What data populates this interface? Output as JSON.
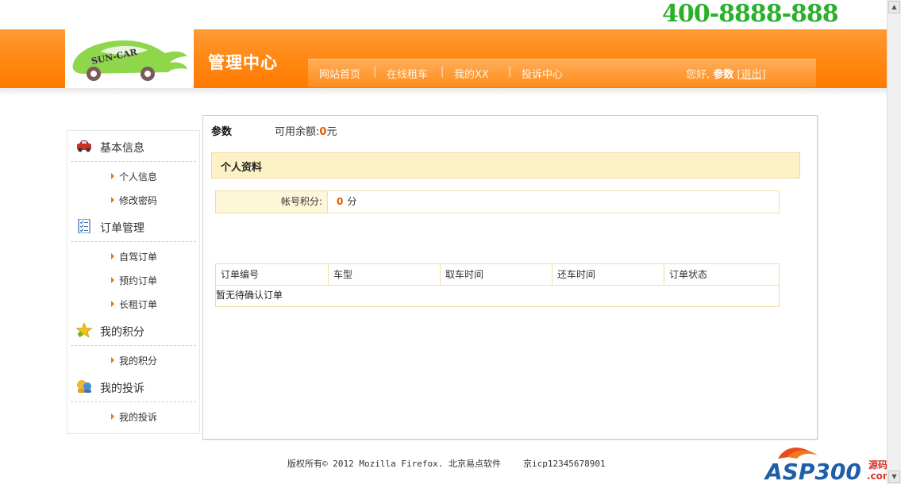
{
  "header": {
    "phone": "400-8888-888",
    "logo_text": "SUN-CAR",
    "title": "管理中心",
    "nav": [
      "网站首页",
      "在线租车",
      "我的XX",
      "投诉中心"
    ],
    "greeting_prefix": "您好,",
    "username": "参数",
    "logout_open": "[",
    "logout_label": "退出",
    "logout_close": "]"
  },
  "sidebar": {
    "sections": [
      {
        "title": "基本信息",
        "icon": "car-icon",
        "items": [
          "个人信息",
          "修改密码"
        ]
      },
      {
        "title": "订单管理",
        "icon": "checklist-icon",
        "items": [
          "自驾订单",
          "预约订单",
          "长租订单"
        ]
      },
      {
        "title": "我的积分",
        "icon": "star-icon",
        "items": [
          "我的积分"
        ]
      },
      {
        "title": "我的投诉",
        "icon": "people-icon",
        "items": [
          "我的投诉"
        ]
      }
    ]
  },
  "main": {
    "username": "参数",
    "balance_label": "可用余额:",
    "balance_value": "0",
    "balance_unit": "元",
    "profile_title": "个人资料",
    "points_label": "帐号积分:",
    "points_value": "0",
    "points_unit": "分",
    "orders": {
      "columns": [
        "订单编号",
        "车型",
        "取车时间",
        "还车时间",
        "订单状态"
      ],
      "empty_text": "暂无待确认订单"
    }
  },
  "footer": {
    "copyright": "版权所有© 2012 Mozilla Firefox. 北京易点软件",
    "icp": "京icp12345678901"
  },
  "watermark": {
    "brand": "ASP300",
    "suffix_top": "源码",
    "suffix_bottom": ".com"
  },
  "colors": {
    "orange": "#ff8a18",
    "phone_green": "#2ab02a",
    "highlight": "#e35b00",
    "pale_yellow": "#fdf2c6"
  }
}
